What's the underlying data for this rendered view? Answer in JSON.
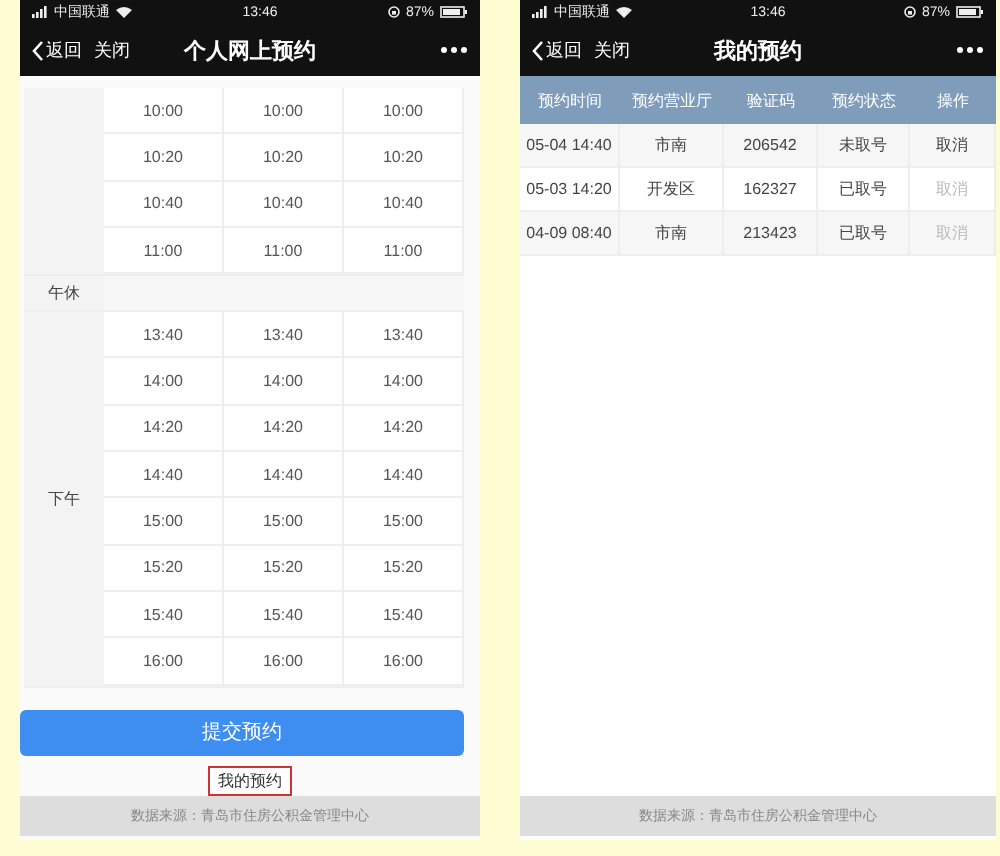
{
  "left": {
    "status_bar": {
      "carrier": "中国联通",
      "time": "13:46",
      "battery": "87%"
    },
    "nav": {
      "back": "返回",
      "close": "关闭",
      "title": "个人网上预约"
    },
    "schedule": [
      {
        "rows": [
          [
            "10:00",
            "10:00",
            "10:00"
          ],
          [
            "10:20",
            "10:20",
            "10:20"
          ],
          [
            "10:40",
            "10:40",
            "10:40"
          ],
          [
            "11:00",
            "11:00",
            "11:00"
          ]
        ]
      },
      {
        "period": "午休"
      },
      {
        "period": "下午",
        "rows": [
          [
            "13:40",
            "13:40",
            "13:40"
          ],
          [
            "14:00",
            "14:00",
            "14:00"
          ],
          [
            "14:20",
            "14:20",
            "14:20"
          ],
          [
            "14:40",
            "14:40",
            "14:40"
          ],
          [
            "15:00",
            "15:00",
            "15:00"
          ],
          [
            "15:20",
            "15:20",
            "15:20"
          ],
          [
            "15:40",
            "15:40",
            "15:40"
          ],
          [
            "16:00",
            "16:00",
            "16:00"
          ]
        ]
      }
    ],
    "submit_button": "提交预约",
    "my_bookings_link": "我的预约",
    "footer": "数据来源：青岛市住房公积金管理中心"
  },
  "right": {
    "status_bar": {
      "carrier": "中国联通",
      "time": "13:46",
      "battery": "87%"
    },
    "nav": {
      "back": "返回",
      "close": "关闭",
      "title": "我的预约"
    },
    "table": {
      "columns": [
        "预约时间",
        "预约营业厅",
        "验证码",
        "预约状态",
        "操作"
      ],
      "rows": [
        {
          "time": "05-04 14:40",
          "hall": "市南",
          "code": "206542",
          "status": "未取号",
          "action": "取消",
          "disabled": false
        },
        {
          "time": "05-03 14:20",
          "hall": "开发区",
          "code": "162327",
          "status": "已取号",
          "action": "取消",
          "disabled": true
        },
        {
          "time": "04-09 08:40",
          "hall": "市南",
          "code": "213423",
          "status": "已取号",
          "action": "取消",
          "disabled": true
        }
      ]
    },
    "footer": "数据来源：青岛市住房公积金管理中心"
  }
}
